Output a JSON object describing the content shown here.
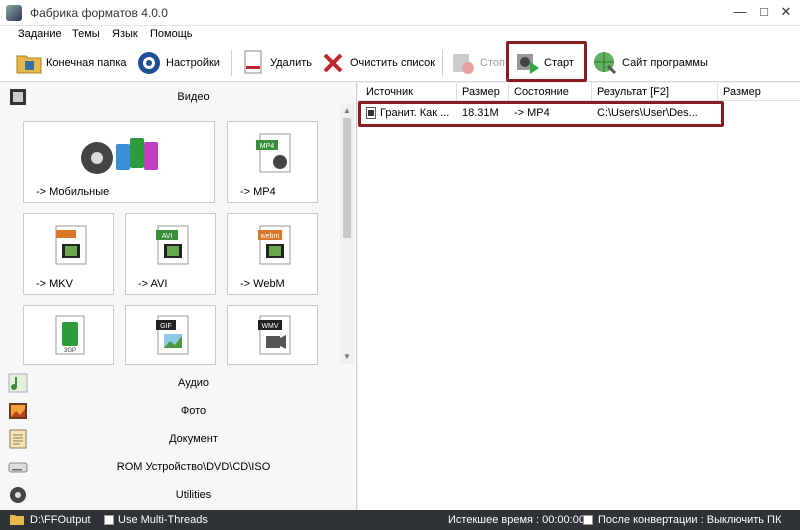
{
  "window": {
    "title": "Фабрика форматов 4.0.0"
  },
  "menu": [
    "Задание",
    "Темы",
    "Язык",
    "Помощь"
  ],
  "toolbar": {
    "output_folder": "Конечная папка",
    "settings": "Настройки",
    "delete": "Удалить",
    "clear_list": "Очистить список",
    "stop": "Стоп",
    "start": "Старт",
    "website": "Сайт программы"
  },
  "categories": {
    "video": "Видео",
    "audio": "Аудио",
    "photo": "Фото",
    "document": "Документ",
    "rom": "ROM Устройство\\DVD\\CD\\ISO",
    "utilities": "Utilities"
  },
  "video_tiles": {
    "mobile": "-> Мобильные",
    "mp4": "-> MP4",
    "mkv": "-> MKV",
    "avi": "-> AVI",
    "webm": "-> WebM",
    "mp4_badge": "MP4",
    "avi_badge": "AVI",
    "webm_badge": "webm",
    "gif_badge": "GIF",
    "wmv_badge": "WMV",
    "3gp_badge": "3GP"
  },
  "list": {
    "columns": [
      "Источник",
      "Размер",
      "Состояние",
      "Результат [F2]",
      "Размер"
    ],
    "rows": [
      {
        "source": "Гранит. Как ...",
        "size": "18.31M",
        "status": "-> MP4",
        "result": "C:\\Users\\User\\Des..."
      }
    ]
  },
  "status": {
    "folder": "D:\\FFOutput",
    "multithread": "Use Multi-Threads",
    "elapsed": "Истекшее время : 00:00:00",
    "after_convert": "После конвертации : Выключить ПК"
  },
  "colors": {
    "highlight": "#8b1c24",
    "statusbar": "#2f3338"
  }
}
